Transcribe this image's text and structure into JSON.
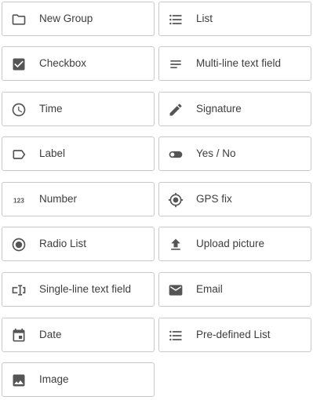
{
  "field_types": {
    "new_group": {
      "label": "New Group",
      "icon": "folder-icon"
    },
    "list": {
      "label": "List",
      "icon": "bulleted-list-icon"
    },
    "checkbox": {
      "label": "Checkbox",
      "icon": "checked-checkbox-icon"
    },
    "multi_line_text": {
      "label": "Multi-line text field",
      "icon": "multiline-text-icon"
    },
    "time": {
      "label": "Time",
      "icon": "clock-icon"
    },
    "signature": {
      "label": "Signature",
      "icon": "pen-icon"
    },
    "label": {
      "label": "Label",
      "icon": "tag-icon"
    },
    "yes_no": {
      "label": "Yes / No",
      "icon": "toggle-icon"
    },
    "number": {
      "label": "Number",
      "icon": "number-123-icon"
    },
    "gps_fix": {
      "label": "GPS fix",
      "icon": "gps-crosshair-icon"
    },
    "radio_list": {
      "label": "Radio List",
      "icon": "radio-button-icon"
    },
    "upload_picture": {
      "label": "Upload picture",
      "icon": "upload-icon"
    },
    "single_line_text": {
      "label": "Single-line text field",
      "icon": "text-cursor-icon"
    },
    "email": {
      "label": "Email",
      "icon": "envelope-icon"
    },
    "date": {
      "label": "Date",
      "icon": "calendar-icon"
    },
    "predefined_list": {
      "label": "Pre-defined List",
      "icon": "bulleted-list-icon"
    },
    "image": {
      "label": "Image",
      "icon": "image-icon"
    }
  },
  "colors": {
    "icon": "#555555",
    "border": "#c9c9c9",
    "text": "#3d3d3d"
  }
}
